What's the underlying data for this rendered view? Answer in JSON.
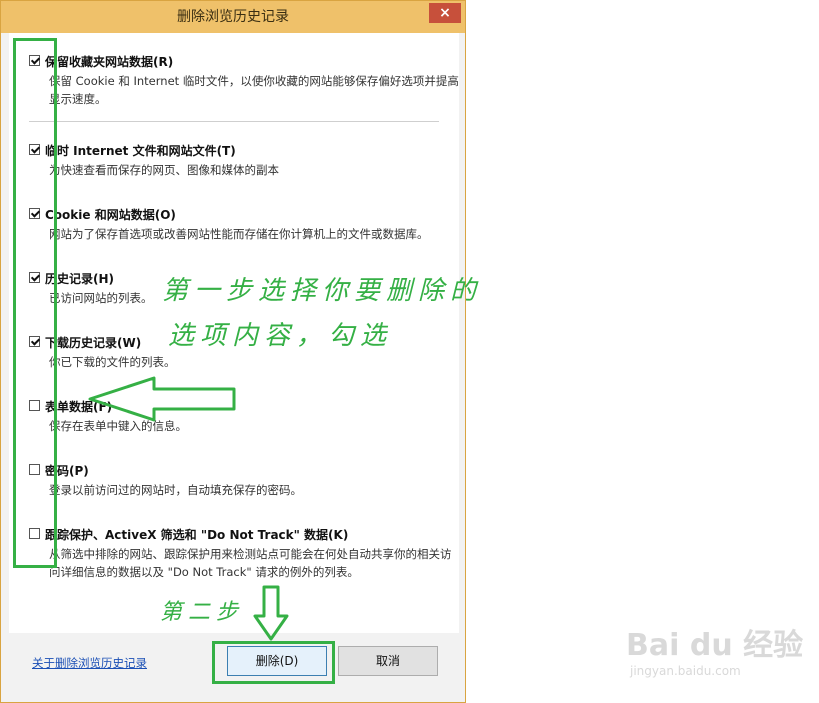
{
  "dialog": {
    "title": "删除浏览历史记录",
    "close_label": "×",
    "options": [
      {
        "title": "保留收藏夹网站数据(R)",
        "desc": "保留 Cookie 和 Internet 临时文件，以使你收藏的网站能够保存偏好选项并提高显示速度。",
        "checked": true
      },
      {
        "title": "临时 Internet 文件和网站文件(T)",
        "desc": "为快速查看而保存的网页、图像和媒体的副本",
        "checked": true
      },
      {
        "title": "Cookie 和网站数据(O)",
        "desc": "网站为了保存首选项或改善网站性能而存储在你计算机上的文件或数据库。",
        "checked": true
      },
      {
        "title": "历史记录(H)",
        "desc": "已访问网站的列表。",
        "checked": true
      },
      {
        "title": "下载历史记录(W)",
        "desc": "你已下载的文件的列表。",
        "checked": true
      },
      {
        "title": "表单数据(F)",
        "desc": "保存在表单中键入的信息。",
        "checked": false
      },
      {
        "title": "密码(P)",
        "desc": "登录以前访问过的网站时，自动填充保存的密码。",
        "checked": false
      },
      {
        "title": "跟踪保护、ActiveX 筛选和 \"Do Not Track\" 数据(K)",
        "desc": "从筛选中排除的网站、跟踪保护用来检测站点可能会在何处自动共享你的相关访问详细信息的数据以及 \"Do Not Track\" 请求的例外的列表。",
        "checked": false
      }
    ],
    "about_link": "关于删除浏览历史记录",
    "delete_button": "删除(D)",
    "cancel_button": "取消"
  },
  "annotations": {
    "step1_line1": "第一步选择你要删除的",
    "step1_line2": "选项内容，勾选",
    "step2": "第二步"
  },
  "watermark": {
    "brand": "Bai du 经验",
    "url": "jingyan.baidu.com"
  },
  "colors": {
    "annotation_green": "#35b045",
    "titlebar": "#efc16a",
    "close": "#c7503b",
    "link": "#1a4fb5"
  }
}
